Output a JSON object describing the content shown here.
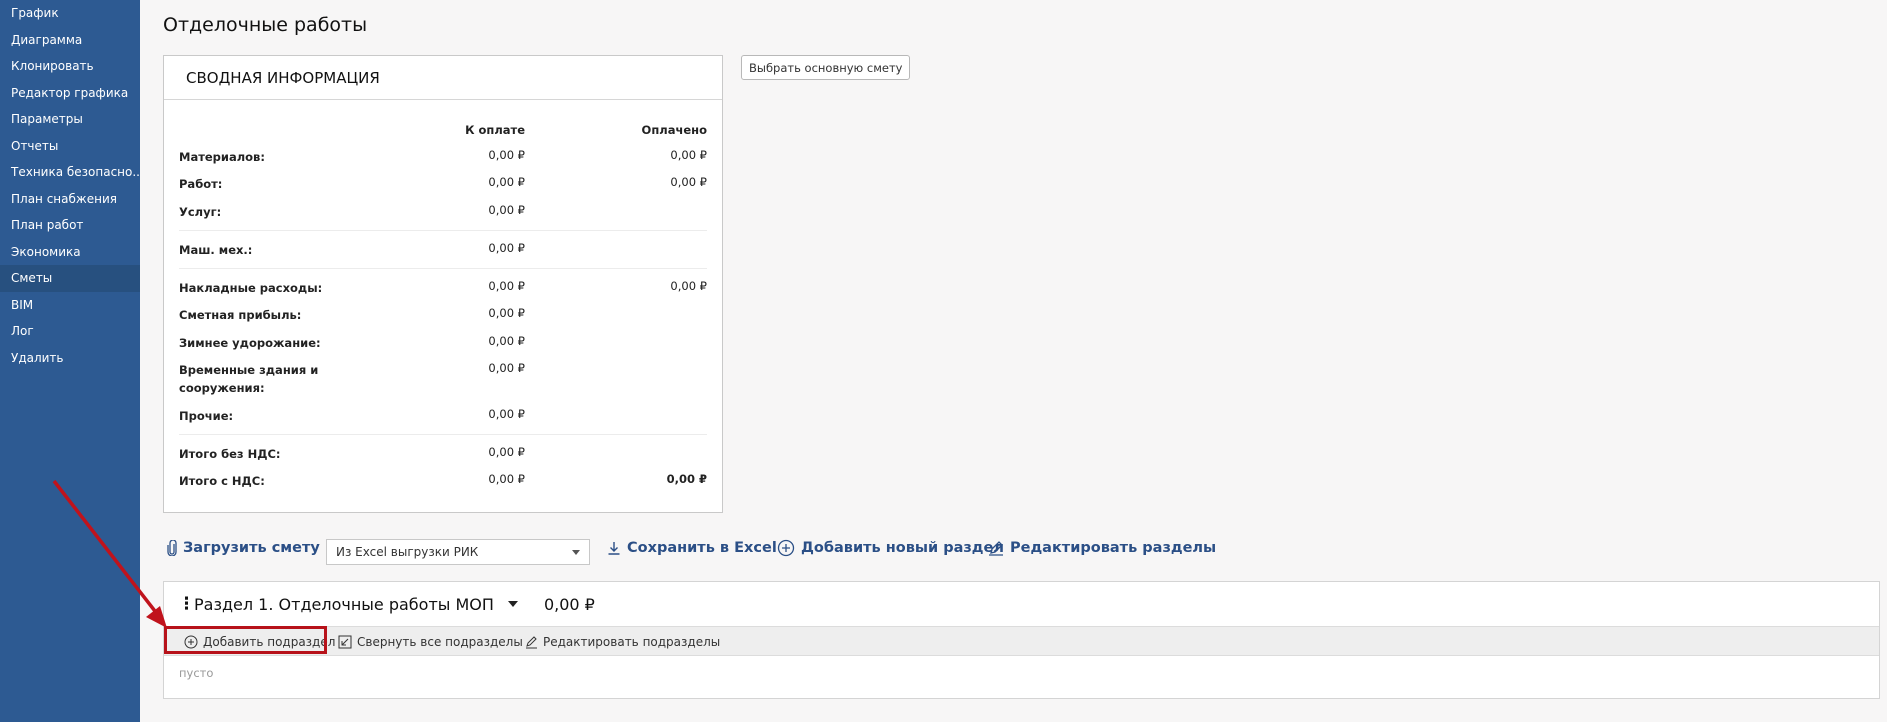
{
  "sidebar": {
    "items": [
      {
        "label": "График"
      },
      {
        "label": "Диаграмма"
      },
      {
        "label": "Клонировать"
      },
      {
        "label": "Редактор графика"
      },
      {
        "label": "Параметры"
      },
      {
        "label": "Отчеты"
      },
      {
        "label": "Техника безопасно..."
      },
      {
        "label": "План снабжения"
      },
      {
        "label": "План работ"
      },
      {
        "label": "Экономика"
      },
      {
        "label": "Сметы",
        "active": true
      },
      {
        "label": "BIM"
      },
      {
        "label": "Лог"
      },
      {
        "label": "Удалить"
      }
    ]
  },
  "page": {
    "title": "Отделочные работы"
  },
  "summary": {
    "title": "СВОДНАЯ ИНФОРМАЦИЯ",
    "col_pay": "К оплате",
    "col_paid": "Оплачено",
    "rows": [
      {
        "label": "Материалов:",
        "pay": "0,00 ₽",
        "paid": "0,00 ₽"
      },
      {
        "label": "Работ:",
        "pay": "0,00 ₽",
        "paid": "0,00 ₽"
      },
      {
        "label": "Услуг:",
        "pay": "0,00 ₽",
        "paid": ""
      },
      {
        "label": "Маш. мех.:",
        "pay": "0,00 ₽",
        "paid": ""
      },
      {
        "label": "Накладные расходы:",
        "pay": "0,00 ₽",
        "paid": "0,00 ₽"
      },
      {
        "label": "Сметная прибыль:",
        "pay": "0,00 ₽",
        "paid": ""
      },
      {
        "label": "Зимнее удорожание:",
        "pay": "0,00 ₽",
        "paid": ""
      },
      {
        "label": "Временные здания и сооружения:",
        "pay": "0,00 ₽",
        "paid": ""
      },
      {
        "label": "Прочие:",
        "pay": "0,00 ₽",
        "paid": ""
      },
      {
        "label": "Итого без НДС:",
        "pay": "0,00 ₽",
        "paid": ""
      },
      {
        "label": "Итого с НДС:",
        "pay": "0,00 ₽",
        "paid": "0,00 ₽"
      }
    ]
  },
  "choose_main_estimate": "Выбрать основную смету",
  "toolbar": {
    "upload": "Загрузить смету",
    "select_value": "Из Excel выгрузки РИК",
    "save_excel": "Сохранить в Excel",
    "add_section": "Добавить новый раздел",
    "edit_sections": "Редактировать разделы"
  },
  "section": {
    "title": "Раздел 1. Отделочные работы МОП",
    "amount": "0,00 ₽",
    "add_subsection": "Добавить подраздел",
    "collapse_all": "Свернуть все подразделы",
    "edit_subsections": "Редактировать подразделы",
    "empty_text": "пусто"
  },
  "colors": {
    "sidebar_bg": "#2d5a92",
    "sidebar_active": "#27507f",
    "link": "#2b4f86",
    "highlight": "#b7121a"
  }
}
